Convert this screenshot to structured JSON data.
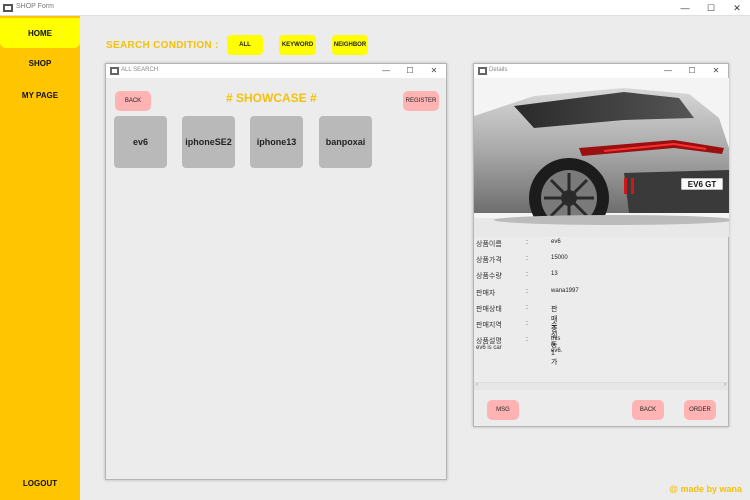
{
  "window": {
    "title": "SHOP Form",
    "minimize": "—",
    "maximize": "☐",
    "close": "✕"
  },
  "sidebar": {
    "items": [
      {
        "label": "HOME"
      },
      {
        "label": "SHOP"
      },
      {
        "label": "MY PAGE"
      }
    ],
    "logout": "LOGOUT"
  },
  "search": {
    "label": "SEARCH CONDITION   :",
    "buttons": [
      {
        "label": "ALL"
      },
      {
        "label": "KEYWORD"
      },
      {
        "label": "NEIGHBOR"
      }
    ]
  },
  "all_search": {
    "title": "ALL SEARCH",
    "back": "BACK",
    "register": "REGISTER",
    "heading": "# SHOWCASE #",
    "products": [
      "ev6",
      "iphoneSE2",
      "iphone13",
      "banpoxai"
    ]
  },
  "details": {
    "title": "Details",
    "image_caption": "EV6 GT",
    "rows": [
      {
        "key": "상품이름",
        "colon": ":",
        "value": "ev6"
      },
      {
        "key": "상품가격",
        "colon": ":",
        "value": "15000"
      },
      {
        "key": "상품수량",
        "colon": ":",
        "value": "13"
      },
      {
        "key": "판매자",
        "colon": ":",
        "value": "wana1997"
      },
      {
        "key": "판매상태",
        "colon": ":",
        "value": "판매중"
      },
      {
        "key": "판매지역",
        "colon": ":",
        "value": "수성동1가"
      },
      {
        "key": "상품설명",
        "colon": ":",
        "value": "this is ev6."
      }
    ],
    "extra_text": "ev6 is car",
    "msg": "MSG",
    "back": "BACK",
    "order": "ORDER"
  },
  "credit": "@  made by wana",
  "colors": {
    "sidebar": "#ffc600",
    "active": "#ffff00",
    "accent": "#f3c10a",
    "pink": "#ffb3b3"
  }
}
